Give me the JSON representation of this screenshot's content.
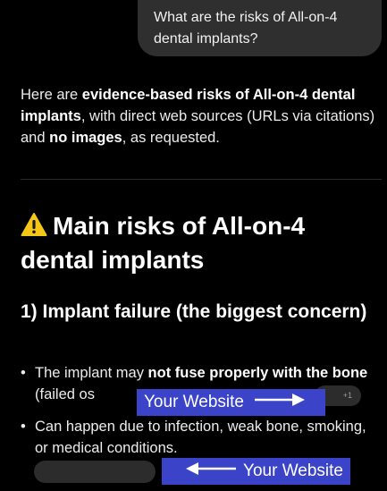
{
  "user_message": "What are the risks of All-on-4 dental implants?",
  "intro": {
    "t1": "Here are ",
    "b1": "evidence-based risks of All-on-4 dental implants",
    "t2": ", with direct web sources (URLs via citations) and ",
    "b2": "no images",
    "t3": ", as requested."
  },
  "heading": "Main risks of All-on-4 dental implants",
  "subheading": "1) Implant failure (the biggest concern)",
  "bullets": [
    {
      "t1": "The implant may ",
      "b1": "not fuse properly with the bone",
      "t2": " (failed os"
    },
    {
      "t1": "Can happen due to infection, weak bone, smoking, or medical conditions."
    }
  ],
  "citation_count": "+1",
  "overlays": [
    {
      "label": "Your Website"
    },
    {
      "label": "Your Website"
    }
  ],
  "colors": {
    "overlay": "#3b44c9",
    "background": "#000000",
    "warning": "#f5c518"
  }
}
